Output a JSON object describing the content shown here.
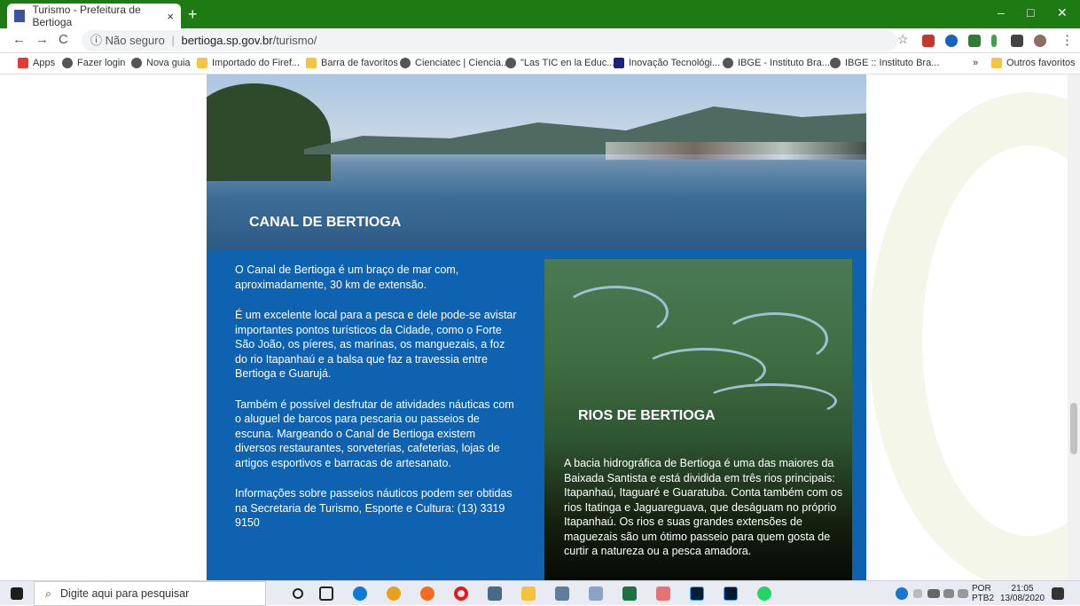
{
  "browser": {
    "tab_title": "Turismo - Prefeitura de Bertioga",
    "tab_close": "×",
    "new_tab": "+",
    "window_controls": {
      "minimize": "–",
      "maximize": "□",
      "close": "✕"
    },
    "nav": {
      "back": "←",
      "forward": "→",
      "reload": "C"
    },
    "url_security": "ⓘ Não seguro",
    "url_sep": "|",
    "url_host": "bertioga.sp.gov.br",
    "url_path": "/turismo/",
    "star": "☆",
    "menu": "⋮"
  },
  "bookmarks": [
    {
      "label": "Apps"
    },
    {
      "label": "Fazer login"
    },
    {
      "label": "Nova guia"
    },
    {
      "label": "Importado do Firef..."
    },
    {
      "label": "Barra de favoritos"
    },
    {
      "label": "Cienciatec | Ciencia..."
    },
    {
      "label": "\"Las TIC en la Educ..."
    },
    {
      "label": "Inovação Tecnológi..."
    },
    {
      "label": "IBGE - Instituto Bra..."
    },
    {
      "label": "IBGE :: Instituto Bra..."
    }
  ],
  "bookmarks_more": "»",
  "bookmarks_other": "Outros favoritos",
  "page": {
    "hero_title": "CANAL DE BERTIOGA",
    "canal_paragraphs": [
      "O Canal de Bertioga é um braço de mar com, aproximadamente, 30 km de extensão.",
      "É um excelente local para a pesca e dele pode-se avistar importantes pontos turísticos da Cidade, como o Forte São João, os píeres, as marinas, os manguezais, a foz do rio Itapanhaú e a balsa que faz a travessia entre Bertioga e Guarujá.",
      "Também é possível desfrutar de atividades náuticas com o aluguel de barcos para pescaria ou passeios de escuna. Margeando o Canal de Bertioga existem diversos restaurantes, sorveterias, cafeterias, lojas de artigos esportivos e barracas de artesanato.",
      "Informações sobre passeios náuticos podem ser obtidas na Secretaria de Turismo, Esporte e Cultura: (13) 3319 9150"
    ],
    "rivers_title": "RIOS DE BERTIOGA",
    "rivers_text": "A bacia hidrográfica de Bertioga é uma das maiores da Baixada Santista e está dividida em três rios principais: Itapanhaú, Itaguaré e Guaratuba. Conta também com os rios Itatinga e Jaguareguava, que deságuam no próprio Itapanhaú. Os rios e suas grandes extensões de maguezais são um ótimo passeio para quem gosta de curtir a natureza ou a pesca amadora."
  },
  "taskbar": {
    "search_placeholder": "Digite aqui para pesquisar",
    "lang_top": "POR",
    "lang_bottom": "PTB2",
    "time": "21:05",
    "date": "13/08/2020"
  },
  "colors": {
    "browser_green": "#1e7a12",
    "site_blue": "#0f62b0"
  }
}
